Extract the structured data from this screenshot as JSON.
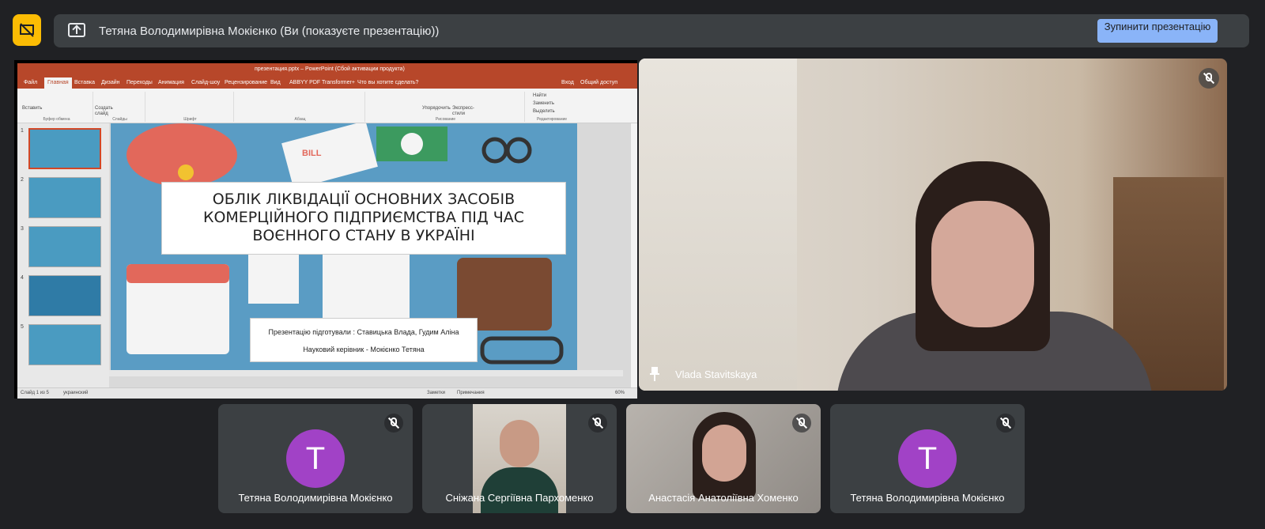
{
  "banner": {
    "text": "Тетяна Володимирівна Мокієнко (Ви (показуєте презентацію))",
    "stop_button": "Зупинити презентацію"
  },
  "presentation": {
    "window_title": "презентация.pptx – PowerPoint (Сбой активации продукта)",
    "menu": [
      "Файл",
      "Главная",
      "Вставка",
      "Дизайн",
      "Переходы",
      "Анимация",
      "Слайд-шоу",
      "Рецензирование",
      "Вид",
      "ABBYY PDF Transformer+",
      "Что вы хотите сделать?",
      "Вход",
      "Общий доступ"
    ],
    "ribbon_groups": [
      "Буфер обмена",
      "Слайды",
      "Шрифт",
      "Абзац",
      "Рисование",
      "Редактирование"
    ],
    "ribbon_buttons": [
      "Вставить",
      "Создать слайд",
      "Упорядочить",
      "Экспресс-стили",
      "Найти",
      "Заменить",
      "Выделить"
    ],
    "thumb_numbers": [
      "1",
      "2",
      "3",
      "4",
      "5"
    ],
    "slide": {
      "title": "ОБЛІК ЛІКВІДАЦІЇ ОСНОВНИХ ЗАСОБІВ КОМЕРЦІЙНОГО ПІДПРИЄМСТВА ПІД ЧАС ВОЄННОГО СТАНУ В УКРАЇНІ",
      "credit_line1": "Презентацію підготували : Ставицька Влада, Гудим Аліна",
      "credit_line2": "Науковий керівник - Мокієнко Тетяна",
      "bill_label": "BILL"
    },
    "status": {
      "slide_count": "Слайд 1 из 5",
      "language": "украинский",
      "notes": "Заметки",
      "comments": "Примечания",
      "zoom": "60%"
    }
  },
  "main_tile": {
    "name": "Vlada Stavitskaya"
  },
  "tiles": [
    {
      "name": "Тетяна Володимирівна Мокієнко",
      "initial": "T",
      "type": "avatar"
    },
    {
      "name": "Сніжана Сергіївна Пархоменко",
      "initial": "",
      "type": "video"
    },
    {
      "name": "Анастасія Анатоліївна Хоменко",
      "initial": "",
      "type": "video"
    },
    {
      "name": "Тетяна Володимирівна Мокієнко",
      "initial": "T",
      "type": "avatar"
    }
  ],
  "colors": {
    "accent": "#8ab4f8",
    "avatar": "#a142c6",
    "present_icon": "#fbbc04",
    "ppt_brand": "#b7472a"
  }
}
